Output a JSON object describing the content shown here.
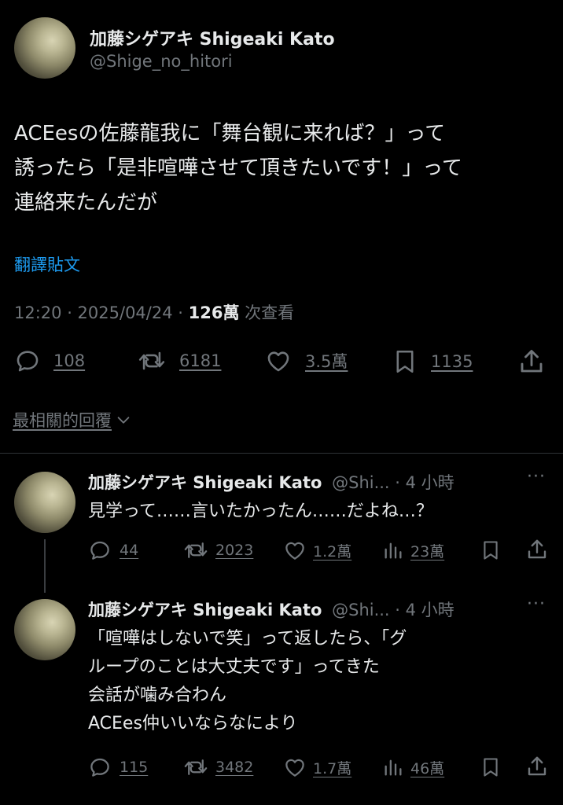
{
  "main": {
    "display_name": "加藤シゲアキ Shigeaki Kato",
    "handle": "@Shige_no_hitori",
    "text_lines": [
      "ACEesの佐藤龍我に「舞台観に来れば？」って",
      "誘ったら「是非喧嘩させて頂きたいです！」って",
      "連絡来たんだが"
    ],
    "translate": "翻譯貼文",
    "time": "12:20 · 2025/04/24 ·",
    "views": "126萬",
    "views_label": "次查看",
    "replies": "108",
    "retweets": "6181",
    "likes": "3.5萬",
    "bookmarks": "1135"
  },
  "sort_label": "最相關的回覆",
  "replies": [
    {
      "display_name": "加藤シゲアキ Shigeaki Kato",
      "handle_time": "@Shi... · 4 小時",
      "lines": [
        "見学って……言いたかったん……だよね…？"
      ],
      "replies": "44",
      "retweets": "2023",
      "likes": "1.2萬",
      "views": "23萬"
    },
    {
      "display_name": "加藤シゲアキ Shigeaki Kato",
      "handle_time": "@Shi... · 4 小時",
      "lines": [
        "「喧嘩はしないで笑」って返したら、「グ",
        "ループのことは大丈夫です」ってきた",
        "会話が噛み合わん",
        "ACEes仲いいならなにより"
      ],
      "replies": "115",
      "retweets": "3482",
      "likes": "1.7萬",
      "views": "46萬"
    }
  ],
  "colors": {
    "background": "#000000",
    "text": "#e7e9ea",
    "muted": "#71767b",
    "link": "#1d9bf0",
    "divider": "#2f3336"
  }
}
